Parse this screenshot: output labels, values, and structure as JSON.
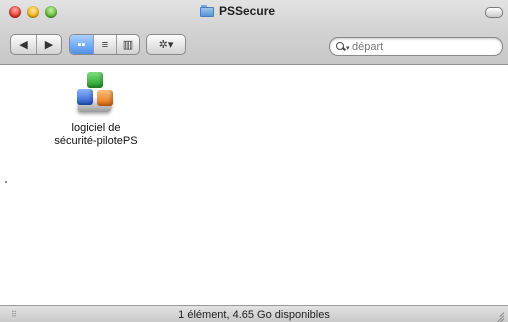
{
  "window": {
    "title": "PSSecure"
  },
  "toolbar": {
    "back_glyph": "◀",
    "forward_glyph": "▶",
    "view_icon_glyph": "▪▪",
    "view_list_glyph": "≡",
    "view_column_glyph": "▥",
    "action_glyph": "✲▾"
  },
  "search": {
    "placeholder": "départ"
  },
  "content": {
    "items": [
      {
        "label_line1": "logiciel de",
        "label_line2": "sécurité-pilotePS",
        "icon": "installer-package-icon"
      }
    ]
  },
  "status": {
    "text": "1 élément, 4.65 Go disponibles"
  }
}
